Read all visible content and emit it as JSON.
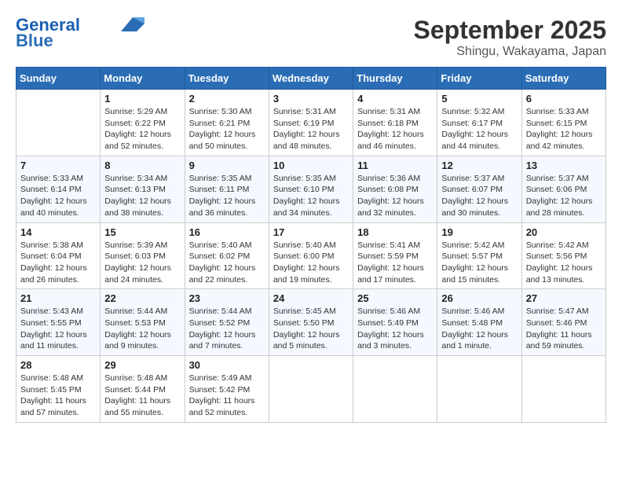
{
  "header": {
    "logo_line1": "General",
    "logo_line2": "Blue",
    "title": "September 2025",
    "subtitle": "Shingu, Wakayama, Japan"
  },
  "calendar": {
    "days_of_week": [
      "Sunday",
      "Monday",
      "Tuesday",
      "Wednesday",
      "Thursday",
      "Friday",
      "Saturday"
    ],
    "weeks": [
      [
        {
          "day": "",
          "info": ""
        },
        {
          "day": "1",
          "info": "Sunrise: 5:29 AM\nSunset: 6:22 PM\nDaylight: 12 hours\nand 52 minutes."
        },
        {
          "day": "2",
          "info": "Sunrise: 5:30 AM\nSunset: 6:21 PM\nDaylight: 12 hours\nand 50 minutes."
        },
        {
          "day": "3",
          "info": "Sunrise: 5:31 AM\nSunset: 6:19 PM\nDaylight: 12 hours\nand 48 minutes."
        },
        {
          "day": "4",
          "info": "Sunrise: 5:31 AM\nSunset: 6:18 PM\nDaylight: 12 hours\nand 46 minutes."
        },
        {
          "day": "5",
          "info": "Sunrise: 5:32 AM\nSunset: 6:17 PM\nDaylight: 12 hours\nand 44 minutes."
        },
        {
          "day": "6",
          "info": "Sunrise: 5:33 AM\nSunset: 6:15 PM\nDaylight: 12 hours\nand 42 minutes."
        }
      ],
      [
        {
          "day": "7",
          "info": "Sunrise: 5:33 AM\nSunset: 6:14 PM\nDaylight: 12 hours\nand 40 minutes."
        },
        {
          "day": "8",
          "info": "Sunrise: 5:34 AM\nSunset: 6:13 PM\nDaylight: 12 hours\nand 38 minutes."
        },
        {
          "day": "9",
          "info": "Sunrise: 5:35 AM\nSunset: 6:11 PM\nDaylight: 12 hours\nand 36 minutes."
        },
        {
          "day": "10",
          "info": "Sunrise: 5:35 AM\nSunset: 6:10 PM\nDaylight: 12 hours\nand 34 minutes."
        },
        {
          "day": "11",
          "info": "Sunrise: 5:36 AM\nSunset: 6:08 PM\nDaylight: 12 hours\nand 32 minutes."
        },
        {
          "day": "12",
          "info": "Sunrise: 5:37 AM\nSunset: 6:07 PM\nDaylight: 12 hours\nand 30 minutes."
        },
        {
          "day": "13",
          "info": "Sunrise: 5:37 AM\nSunset: 6:06 PM\nDaylight: 12 hours\nand 28 minutes."
        }
      ],
      [
        {
          "day": "14",
          "info": "Sunrise: 5:38 AM\nSunset: 6:04 PM\nDaylight: 12 hours\nand 26 minutes."
        },
        {
          "day": "15",
          "info": "Sunrise: 5:39 AM\nSunset: 6:03 PM\nDaylight: 12 hours\nand 24 minutes."
        },
        {
          "day": "16",
          "info": "Sunrise: 5:40 AM\nSunset: 6:02 PM\nDaylight: 12 hours\nand 22 minutes."
        },
        {
          "day": "17",
          "info": "Sunrise: 5:40 AM\nSunset: 6:00 PM\nDaylight: 12 hours\nand 19 minutes."
        },
        {
          "day": "18",
          "info": "Sunrise: 5:41 AM\nSunset: 5:59 PM\nDaylight: 12 hours\nand 17 minutes."
        },
        {
          "day": "19",
          "info": "Sunrise: 5:42 AM\nSunset: 5:57 PM\nDaylight: 12 hours\nand 15 minutes."
        },
        {
          "day": "20",
          "info": "Sunrise: 5:42 AM\nSunset: 5:56 PM\nDaylight: 12 hours\nand 13 minutes."
        }
      ],
      [
        {
          "day": "21",
          "info": "Sunrise: 5:43 AM\nSunset: 5:55 PM\nDaylight: 12 hours\nand 11 minutes."
        },
        {
          "day": "22",
          "info": "Sunrise: 5:44 AM\nSunset: 5:53 PM\nDaylight: 12 hours\nand 9 minutes."
        },
        {
          "day": "23",
          "info": "Sunrise: 5:44 AM\nSunset: 5:52 PM\nDaylight: 12 hours\nand 7 minutes."
        },
        {
          "day": "24",
          "info": "Sunrise: 5:45 AM\nSunset: 5:50 PM\nDaylight: 12 hours\nand 5 minutes."
        },
        {
          "day": "25",
          "info": "Sunrise: 5:46 AM\nSunset: 5:49 PM\nDaylight: 12 hours\nand 3 minutes."
        },
        {
          "day": "26",
          "info": "Sunrise: 5:46 AM\nSunset: 5:48 PM\nDaylight: 12 hours\nand 1 minute."
        },
        {
          "day": "27",
          "info": "Sunrise: 5:47 AM\nSunset: 5:46 PM\nDaylight: 11 hours\nand 59 minutes."
        }
      ],
      [
        {
          "day": "28",
          "info": "Sunrise: 5:48 AM\nSunset: 5:45 PM\nDaylight: 11 hours\nand 57 minutes."
        },
        {
          "day": "29",
          "info": "Sunrise: 5:48 AM\nSunset: 5:44 PM\nDaylight: 11 hours\nand 55 minutes."
        },
        {
          "day": "30",
          "info": "Sunrise: 5:49 AM\nSunset: 5:42 PM\nDaylight: 11 hours\nand 52 minutes."
        },
        {
          "day": "",
          "info": ""
        },
        {
          "day": "",
          "info": ""
        },
        {
          "day": "",
          "info": ""
        },
        {
          "day": "",
          "info": ""
        }
      ]
    ]
  }
}
